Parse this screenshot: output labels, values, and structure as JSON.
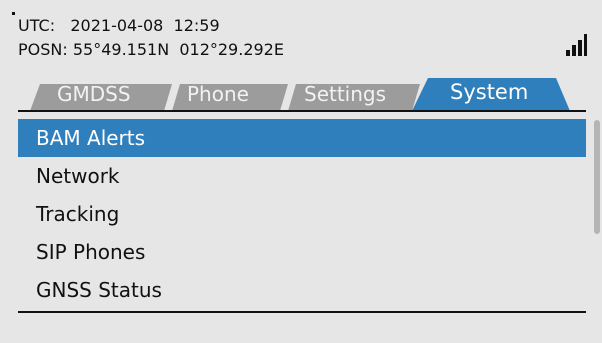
{
  "status": {
    "utc_line": "UTC:   2021-04-08  12:59",
    "posn_line": "POSN: 55°49.151N  012°29.292E"
  },
  "signal": {
    "icon": "signal-strength-icon",
    "level": 4
  },
  "tabs": [
    {
      "label": "GMDSS",
      "active": false
    },
    {
      "label": "Phone",
      "active": false
    },
    {
      "label": "Settings",
      "active": false
    },
    {
      "label": "System",
      "active": true
    }
  ],
  "menu": {
    "items": [
      {
        "label": "BAM Alerts",
        "selected": true
      },
      {
        "label": "Network",
        "selected": false
      },
      {
        "label": "Tracking",
        "selected": false
      },
      {
        "label": "SIP Phones",
        "selected": false
      },
      {
        "label": "GNSS Status",
        "selected": false
      }
    ]
  },
  "colors": {
    "background": "#e6e6e6",
    "selection": "#2f7fbc",
    "active_tab": "#2f7fbc",
    "inactive_tab": "#9c9c9c",
    "text": "#111111"
  }
}
